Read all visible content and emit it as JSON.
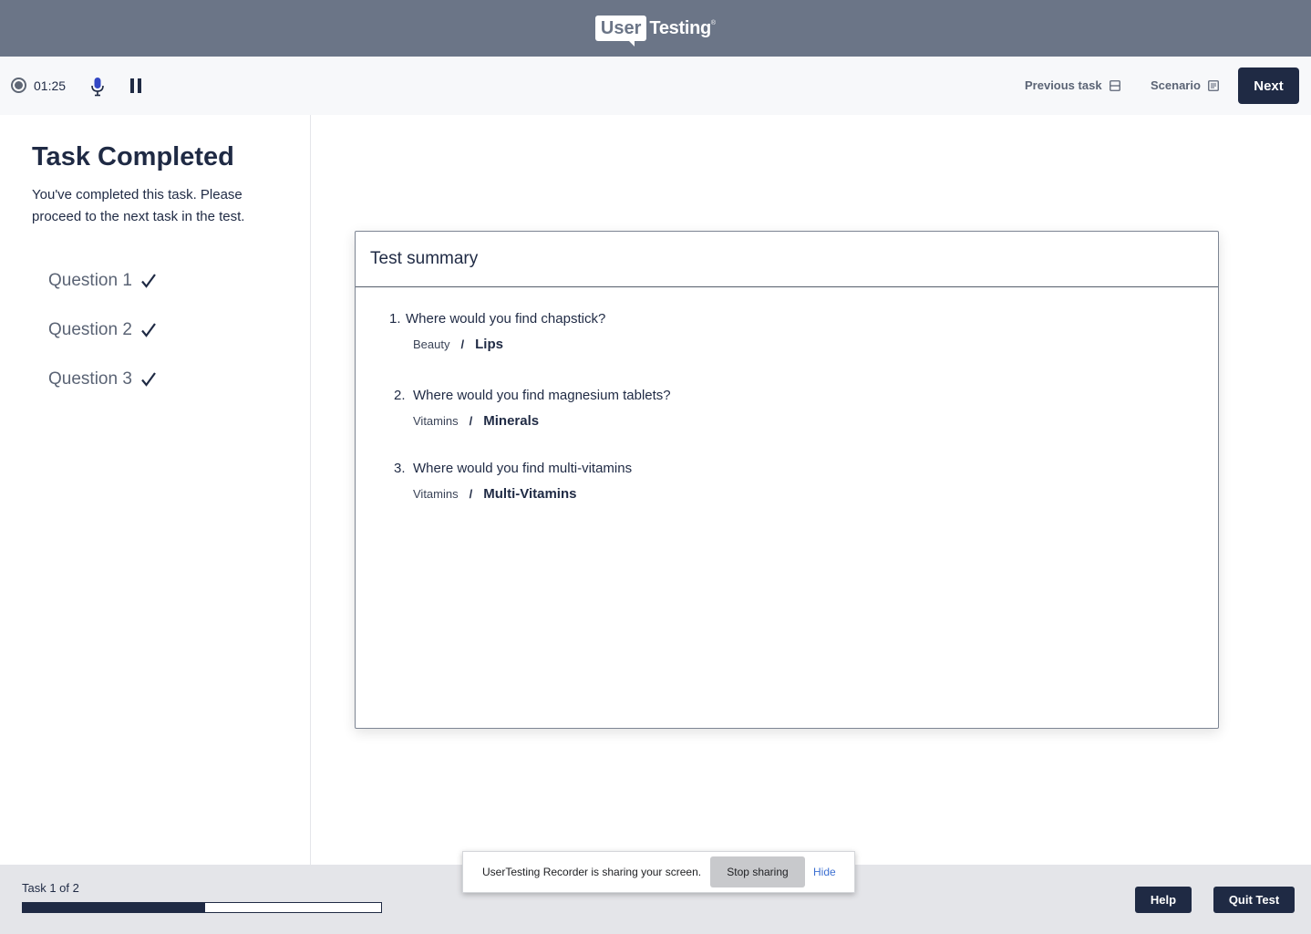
{
  "brand": {
    "logo_user": "User",
    "logo_testing": "Testing",
    "logo_reg": "®"
  },
  "controls": {
    "timer": "01:25",
    "previous_task_label": "Previous task",
    "scenario_label": "Scenario",
    "next_label": "Next"
  },
  "task_panel": {
    "title": "Task Completed",
    "description": "You've completed this task. Please proceed to the next task in the test.",
    "questions": [
      {
        "label": "Question 1",
        "status": "completed"
      },
      {
        "label": "Question 2",
        "status": "completed"
      },
      {
        "label": "Question 3",
        "status": "completed"
      }
    ]
  },
  "summary": {
    "title": "Test summary",
    "items": [
      {
        "number": "1.",
        "question": "Where would you find chapstick?",
        "category": "Beauty",
        "separator": "/",
        "answer": "Lips"
      },
      {
        "number": "2.",
        "question": "Where would you find magnesium tablets?",
        "category": "Vitamins",
        "separator": "/",
        "answer": "Minerals"
      },
      {
        "number": "3.",
        "question": "Where would you find multi-vitamins",
        "category": "Vitamins",
        "separator": "/",
        "answer": "Multi-Vitamins"
      }
    ]
  },
  "footer": {
    "task_count": "Task 1 of 2",
    "progress_fraction": 0.51,
    "help_label": "Help",
    "quit_label": "Quit Test"
  },
  "screen_share": {
    "message": "UserTesting Recorder is sharing your screen.",
    "stop_label": "Stop sharing",
    "hide_label": "Hide"
  },
  "colors": {
    "brand_bar": "#6b7587",
    "primary": "#1f2a44",
    "muted_text": "#5b6475",
    "link": "#3c6fd1"
  }
}
